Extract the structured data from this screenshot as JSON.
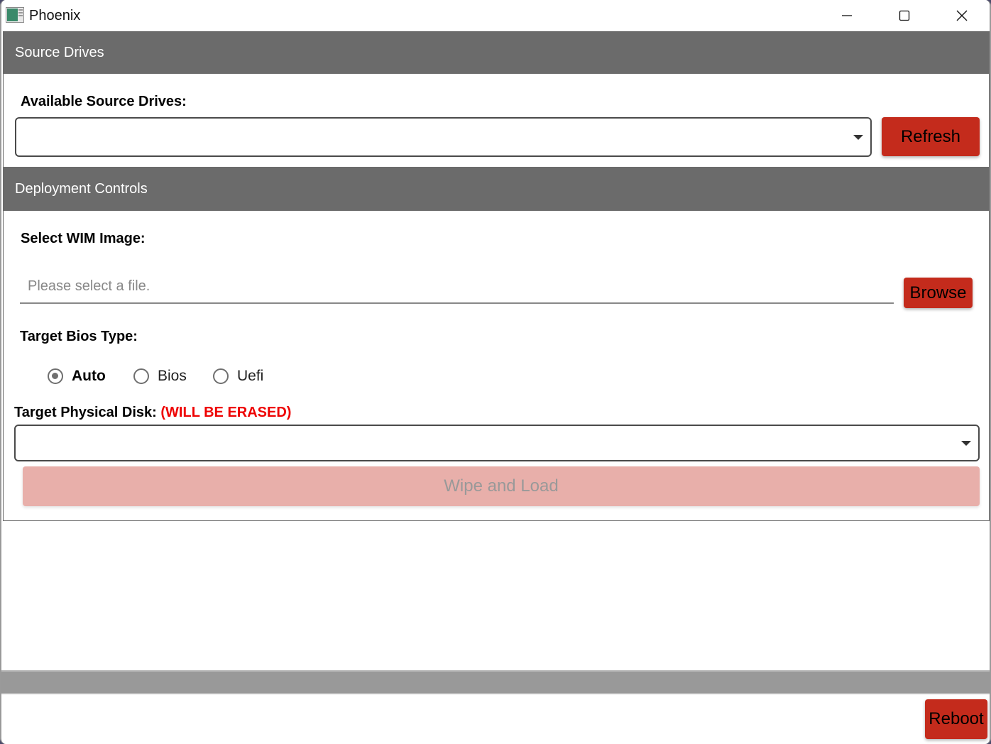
{
  "window": {
    "title": "Phoenix",
    "icon": "app-window-icon",
    "controls": {
      "minimize": "minimize-icon",
      "maximize": "maximize-icon",
      "close": "close-icon"
    }
  },
  "source_drives": {
    "header": "Source Drives",
    "label": "Available Source Drives:",
    "selected_value": "",
    "refresh_label": "Refresh"
  },
  "deployment": {
    "header": "Deployment Controls",
    "wim_label": "Select WIM Image:",
    "wim_value": "",
    "wim_placeholder": "Please select a file.",
    "browse_label": "Browse",
    "bios_label": "Target Bios Type:",
    "bios_options": [
      {
        "label": "Auto",
        "checked": true
      },
      {
        "label": "Bios",
        "checked": false
      },
      {
        "label": "Uefi",
        "checked": false
      }
    ],
    "disk_label": "Target Physical Disk:",
    "disk_warning": "(WILL BE ERASED)",
    "disk_selected_value": "",
    "wipe_label": "Wipe and Load",
    "wipe_enabled": false
  },
  "footer": {
    "reboot_label": "Reboot"
  },
  "colors": {
    "accent_red": "#c42b1c",
    "warning_red": "#ee0000",
    "header_gray": "#6b6b6b",
    "disabled_button": "#e8afaa"
  }
}
